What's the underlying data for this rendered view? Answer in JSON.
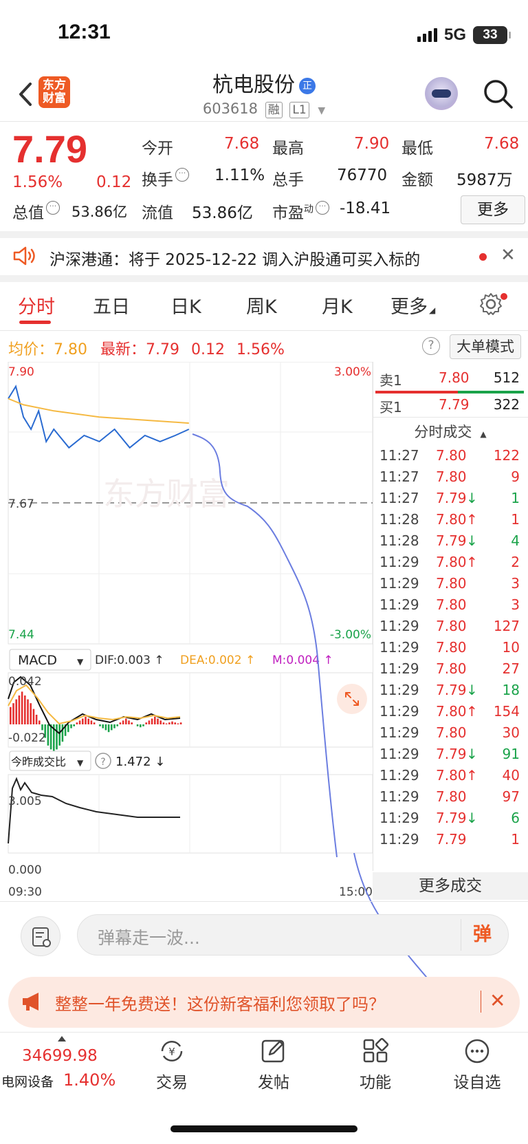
{
  "status": {
    "time": "12:31",
    "network": "5G",
    "battery": "33"
  },
  "header": {
    "logo_line1": "东方",
    "logo_line2": "财富",
    "stock_name": "杭电股份",
    "name_badge": "正",
    "code": "603618",
    "tag1": "融",
    "tag2": "L1"
  },
  "quote": {
    "price": "7.79",
    "change_pct": "1.56%",
    "change": "0.12",
    "open_label": "今开",
    "open": "7.68",
    "high_label": "最高",
    "high": "7.90",
    "low_label": "最低",
    "low": "7.68",
    "turnover_label": "换手",
    "turnover": "1.11%",
    "volume_label": "总手",
    "volume": "76770",
    "amount_label": "金额",
    "amount": "5987万",
    "mcap_label": "总值",
    "mcap": "53.86亿",
    "float_label": "流值",
    "float_cap": "53.86亿",
    "pe_label": "市盈",
    "pe_sup": "动",
    "pe": "-18.41",
    "more_label": "更多"
  },
  "notice": {
    "text": "沪深港通：将于 2025-12-22 调入沪股通可买入标的"
  },
  "tabs": [
    "分时",
    "五日",
    "日K",
    "周K",
    "月K",
    "更多"
  ],
  "info": {
    "avg_label": "均价：",
    "avg": "7.80",
    "latest_label": "最新：",
    "latest": "7.79",
    "change": "0.12",
    "pct": "1.56%",
    "mode_label": "大单模式"
  },
  "chart_labels": {
    "y_top": "7.90",
    "y_top_pct": "3.00%",
    "y_mid": "7.67",
    "y_bot": "7.44",
    "y_bot_pct": "-3.00%",
    "watermark": "东方财富",
    "macd_label": "MACD",
    "dif": "DIF:0.003 ↑",
    "dea": "DEA:0.002 ↑",
    "m": "M:0.004 ↑",
    "macd_top": "0.042",
    "macd_bot": "-0.022",
    "vr_label": "今昨成交比",
    "vr_val": "1.472 ↓",
    "vr_top": "3.005",
    "vr_bot": "0.000",
    "x_start": "09:30",
    "x_end": "15:00"
  },
  "chart_data": {
    "type": "line",
    "title": "",
    "x_range": [
      "09:30",
      "15:00"
    ],
    "ylim": [
      7.44,
      7.9
    ],
    "prev_close": 7.67,
    "series": [
      {
        "name": "最新",
        "x": [
          "09:30",
          "09:35",
          "09:40",
          "09:45",
          "09:50",
          "09:55",
          "10:00",
          "10:10",
          "10:20",
          "10:30",
          "10:40",
          "10:50",
          "11:00",
          "11:10",
          "11:20",
          "11:29"
        ],
        "values": [
          7.84,
          7.86,
          7.81,
          7.79,
          7.82,
          7.77,
          7.79,
          7.76,
          7.78,
          7.77,
          7.79,
          7.76,
          7.78,
          7.77,
          7.78,
          7.79
        ]
      },
      {
        "name": "均价",
        "x": [
          "09:30",
          "09:40",
          "10:00",
          "10:30",
          "11:00",
          "11:29"
        ],
        "values": [
          7.84,
          7.83,
          7.82,
          7.81,
          7.805,
          7.8
        ]
      }
    ]
  },
  "order_book": {
    "sell": {
      "label": "卖1",
      "price": "7.80",
      "vol": "512"
    },
    "buy": {
      "label": "买1",
      "price": "7.79",
      "vol": "322"
    }
  },
  "trades": {
    "header": "分时成交",
    "rows": [
      {
        "time": "11:27",
        "price": "7.80",
        "arrow": "",
        "vol": "122",
        "dir": "up"
      },
      {
        "time": "11:27",
        "price": "7.80",
        "arrow": "",
        "vol": "9",
        "dir": "up"
      },
      {
        "time": "11:27",
        "price": "7.79",
        "arrow": "↓",
        "vol": "1",
        "dir": "down"
      },
      {
        "time": "11:28",
        "price": "7.80",
        "arrow": "↑",
        "vol": "1",
        "dir": "up"
      },
      {
        "time": "11:28",
        "price": "7.79",
        "arrow": "↓",
        "vol": "4",
        "dir": "down"
      },
      {
        "time": "11:29",
        "price": "7.80",
        "arrow": "↑",
        "vol": "2",
        "dir": "up"
      },
      {
        "time": "11:29",
        "price": "7.80",
        "arrow": "",
        "vol": "3",
        "dir": "up"
      },
      {
        "time": "11:29",
        "price": "7.80",
        "arrow": "",
        "vol": "3",
        "dir": "up"
      },
      {
        "time": "11:29",
        "price": "7.80",
        "arrow": "",
        "vol": "127",
        "dir": "up"
      },
      {
        "time": "11:29",
        "price": "7.80",
        "arrow": "",
        "vol": "10",
        "dir": "up"
      },
      {
        "time": "11:29",
        "price": "7.80",
        "arrow": "",
        "vol": "27",
        "dir": "up"
      },
      {
        "time": "11:29",
        "price": "7.79",
        "arrow": "↓",
        "vol": "18",
        "dir": "down"
      },
      {
        "time": "11:29",
        "price": "7.80",
        "arrow": "↑",
        "vol": "154",
        "dir": "up"
      },
      {
        "time": "11:29",
        "price": "7.80",
        "arrow": "",
        "vol": "30",
        "dir": "up"
      },
      {
        "time": "11:29",
        "price": "7.79",
        "arrow": "↓",
        "vol": "91",
        "dir": "down"
      },
      {
        "time": "11:29",
        "price": "7.80",
        "arrow": "↑",
        "vol": "40",
        "dir": "up"
      },
      {
        "time": "11:29",
        "price": "7.80",
        "arrow": "",
        "vol": "97",
        "dir": "up"
      },
      {
        "time": "11:29",
        "price": "7.79",
        "arrow": "↓",
        "vol": "6",
        "dir": "down"
      },
      {
        "time": "11:29",
        "price": "7.79",
        "arrow": "",
        "vol": "1",
        "dir": "up"
      }
    ],
    "more_label": "更多成交"
  },
  "comment": {
    "placeholder": "弹幕走一波...",
    "danmu_label": "弹"
  },
  "promo": {
    "text": "整整一年免费送！这份新客福利您领取了吗？",
    "close": "✕"
  },
  "bottom_nav": {
    "index_value": "34699.98",
    "index_name": "电网设备",
    "index_pct": "1.40%",
    "items": [
      "交易",
      "发帖",
      "功能",
      "设自选"
    ]
  },
  "colors": {
    "up": "#e5302f",
    "down": "#1aa34a",
    "avg": "#f5b942",
    "price_line": "#2a6bd1",
    "accent": "#ee5a24"
  }
}
